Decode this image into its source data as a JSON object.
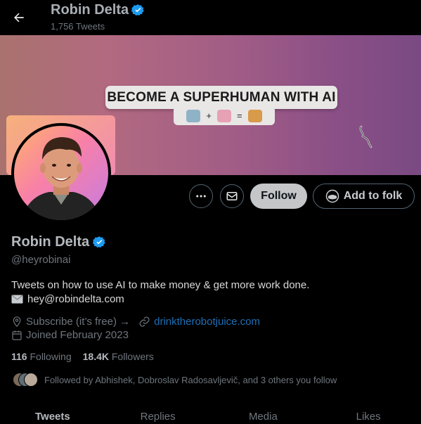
{
  "header": {
    "name": "Robin Delta",
    "tweet_count": "1,756 Tweets"
  },
  "banner": {
    "title": "BECOME A SUPERHUMAN WITH AI",
    "formula_plus": "+",
    "formula_equals": "="
  },
  "actions": {
    "follow_label": "Follow",
    "folk_label": "Add to folk"
  },
  "profile": {
    "name": "Robin Delta",
    "handle": "@heyrobinai",
    "bio": "Tweets on how to use AI to make money & get more work done.",
    "email": "hey@robindelta.com",
    "subscribe": "Subscribe (it’s free) →",
    "link": "drinktherobotjuice.com",
    "joined": "Joined February 2023"
  },
  "stats": {
    "following_count": "116",
    "following_label": "Following",
    "followers_count": "18.4K",
    "followers_label": "Followers"
  },
  "followed_by": "Followed by Abhishek, Dobroslav Radosavljevič, and 3 others you follow",
  "tabs": [
    "Tweets",
    "Replies",
    "Media",
    "Likes"
  ],
  "colors": {
    "background": "#000000",
    "verified": "#1d9bf0",
    "link": "#1d6fb5",
    "follow_button": "#c4c6c8"
  },
  "icons": [
    "back-arrow-icon",
    "verified-badge-icon",
    "more-icon",
    "mail-icon",
    "folk-icon",
    "envelope-emoji-icon",
    "location-icon",
    "link-icon",
    "calendar-icon"
  ]
}
